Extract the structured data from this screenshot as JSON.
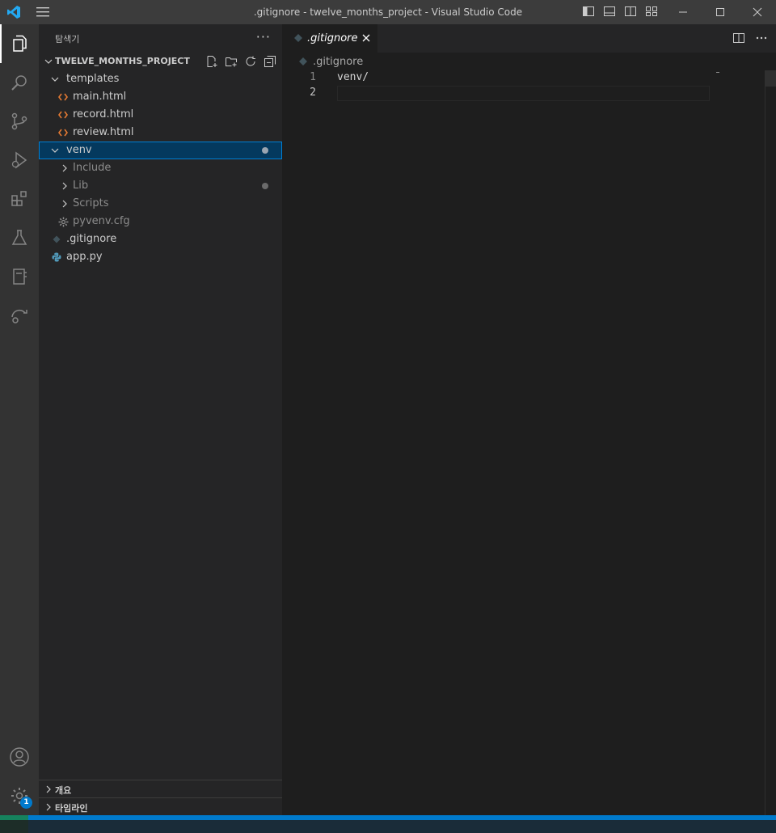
{
  "window": {
    "title": ".gitignore - twelve_months_project - Visual Studio Code"
  },
  "activity_bar": {
    "items": [
      "explorer-icon",
      "search-icon",
      "source-control-icon",
      "run-debug-icon",
      "extensions-icon",
      "testing-icon",
      "notebook-icon",
      "remote-explorer-icon"
    ],
    "accounts": "accounts-icon",
    "manage": "gear-icon",
    "manage_badge": "1"
  },
  "sidebar": {
    "title": "탐색기",
    "more": "···",
    "project": "TWELVE_MONTHS_PROJECT",
    "tree": [
      {
        "label": "templates",
        "type": "folder",
        "expanded": true,
        "depth": 0
      },
      {
        "label": "main.html",
        "type": "html",
        "depth": 1
      },
      {
        "label": "record.html",
        "type": "html",
        "depth": 1
      },
      {
        "label": "review.html",
        "type": "html",
        "depth": 1
      },
      {
        "label": "venv",
        "type": "folder",
        "expanded": true,
        "depth": 0,
        "selected": true
      },
      {
        "label": "Include",
        "type": "folder",
        "expanded": false,
        "depth": 1
      },
      {
        "label": "Lib",
        "type": "folder",
        "expanded": false,
        "depth": 1
      },
      {
        "label": "Scripts",
        "type": "folder",
        "expanded": false,
        "depth": 1
      },
      {
        "label": "pyvenv.cfg",
        "type": "cfg",
        "depth": 1
      },
      {
        "label": ".gitignore",
        "type": "git",
        "depth": 0
      },
      {
        "label": "app.py",
        "type": "python",
        "depth": 0
      }
    ],
    "sections": [
      {
        "label": "개요"
      },
      {
        "label": "타임라인"
      }
    ]
  },
  "editor": {
    "tab_label": ".gitignore",
    "breadcrumb": ".gitignore",
    "lines": [
      {
        "num": "1",
        "text": "venv/"
      },
      {
        "num": "2",
        "text": ""
      }
    ]
  },
  "colors": {
    "titlebar": "#3c3c3c",
    "activitybar": "#333333",
    "sidebar": "#252526",
    "editor": "#1e1e1e",
    "accent": "#007acc",
    "html_icon": "#e37933",
    "python_icon": "#519aba"
  }
}
